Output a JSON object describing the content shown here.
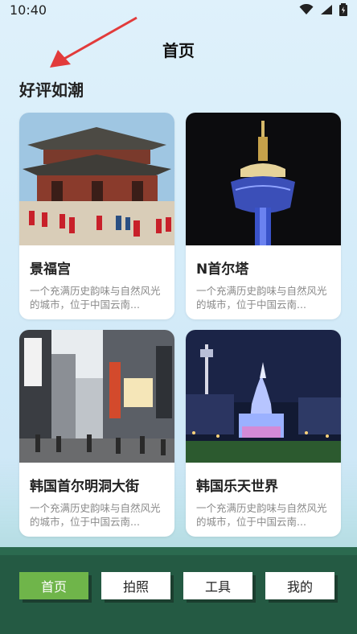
{
  "status": {
    "time": "10:40"
  },
  "header": {
    "title": "首页"
  },
  "section": {
    "title": "好评如潮"
  },
  "cards": [
    {
      "name": "景福宫",
      "desc": "一个充满历史韵味与自然风光的城市，位于中国云南..."
    },
    {
      "name": "N首尔塔",
      "desc": "一个充满历史韵味与自然风光的城市，位于中国云南..."
    },
    {
      "name": "韩国首尔明洞大街",
      "desc": "一个充满历史韵味与自然风光的城市，位于中国云南..."
    },
    {
      "name": "韩国乐天世界",
      "desc": "一个充满历史韵味与自然风光的城市，位于中国云南..."
    }
  ],
  "tabs": [
    {
      "label": "首页",
      "active": true
    },
    {
      "label": "拍照",
      "active": false
    },
    {
      "label": "工具",
      "active": false
    },
    {
      "label": "我的",
      "active": false
    }
  ],
  "colors": {
    "accent": "#6fb54a",
    "nav_bg": "#245a43",
    "arrow": "#e23b3b"
  }
}
